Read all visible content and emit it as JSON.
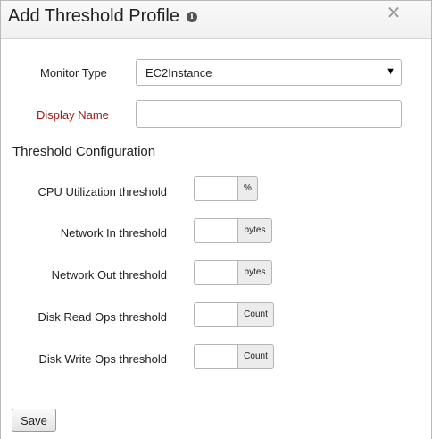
{
  "dialog": {
    "title": "Add Threshold Profile",
    "info_icon": "info-icon",
    "close_icon": "close-icon",
    "close_glyph": "✕"
  },
  "form": {
    "monitor_type": {
      "label": "Monitor Type",
      "value": "EC2Instance"
    },
    "display_name": {
      "label": "Display Name",
      "value": "",
      "label_color": "#a01818"
    }
  },
  "threshold_config": {
    "title": "Threshold Configuration",
    "rows": [
      {
        "label": "CPU Utilization threshold",
        "value": "",
        "unit": "%"
      },
      {
        "label": "Network In threshold",
        "value": "",
        "unit": "bytes"
      },
      {
        "label": "Network Out threshold",
        "value": "",
        "unit": "bytes"
      },
      {
        "label": "Disk Read Ops threshold",
        "value": "",
        "unit": "Count"
      },
      {
        "label": "Disk Write Ops threshold",
        "value": "",
        "unit": "Count"
      }
    ]
  },
  "footer": {
    "save_label": "Save"
  }
}
